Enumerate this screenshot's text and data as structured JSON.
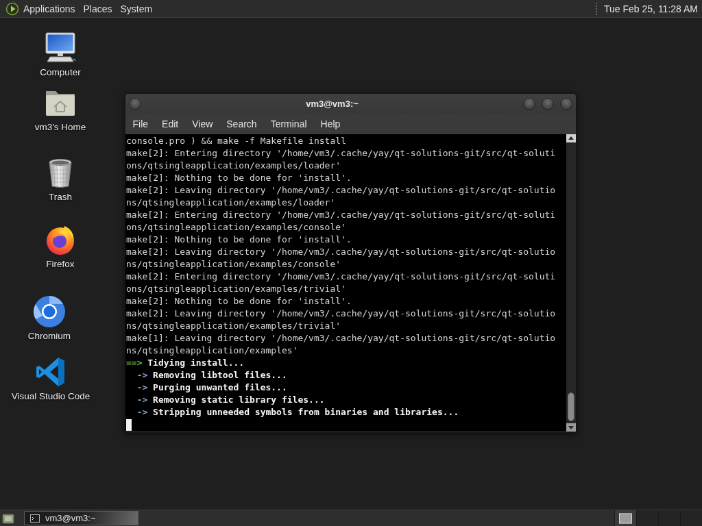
{
  "top_panel": {
    "menus": [
      "Applications",
      "Places",
      "System"
    ],
    "clock": "Tue Feb 25, 11:28 AM"
  },
  "desktop_icons": [
    {
      "kind": "computer",
      "label": "Computer"
    },
    {
      "kind": "home",
      "label": "vm3's Home"
    },
    {
      "kind": "trash",
      "label": "Trash"
    },
    {
      "kind": "firefox",
      "label": "Firefox"
    },
    {
      "kind": "chromium",
      "label": "Chromium"
    },
    {
      "kind": "vscode",
      "label": "Visual Studio Code"
    }
  ],
  "terminal_window": {
    "title": "vm3@vm3:~",
    "menu": [
      "File",
      "Edit",
      "View",
      "Search",
      "Terminal",
      "Help"
    ],
    "cursor": true,
    "lines": [
      {
        "kind": "output",
        "text": "console.pro ) && make -f Makefile install"
      },
      {
        "kind": "output",
        "text": "make[2]: Entering directory '/home/vm3/.cache/yay/qt-solutions-git/src/qt-soluti"
      },
      {
        "kind": "output",
        "text": "ons/qtsingleapplication/examples/loader'"
      },
      {
        "kind": "output",
        "text": "make[2]: Nothing to be done for 'install'."
      },
      {
        "kind": "output",
        "text": "make[2]: Leaving directory '/home/vm3/.cache/yay/qt-solutions-git/src/qt-solutio"
      },
      {
        "kind": "output",
        "text": "ns/qtsingleapplication/examples/loader'"
      },
      {
        "kind": "output",
        "text": "make[2]: Entering directory '/home/vm3/.cache/yay/qt-solutions-git/src/qt-soluti"
      },
      {
        "kind": "output",
        "text": "ons/qtsingleapplication/examples/console'"
      },
      {
        "kind": "output",
        "text": "make[2]: Nothing to be done for 'install'."
      },
      {
        "kind": "output",
        "text": "make[2]: Leaving directory '/home/vm3/.cache/yay/qt-solutions-git/src/qt-solutio"
      },
      {
        "kind": "output",
        "text": "ns/qtsingleapplication/examples/console'"
      },
      {
        "kind": "output",
        "text": "make[2]: Entering directory '/home/vm3/.cache/yay/qt-solutions-git/src/qt-soluti"
      },
      {
        "kind": "output",
        "text": "ons/qtsingleapplication/examples/trivial'"
      },
      {
        "kind": "output",
        "text": "make[2]: Nothing to be done for 'install'."
      },
      {
        "kind": "output",
        "text": "make[2]: Leaving directory '/home/vm3/.cache/yay/qt-solutions-git/src/qt-solutio"
      },
      {
        "kind": "output",
        "text": "ns/qtsingleapplication/examples/trivial'"
      },
      {
        "kind": "output",
        "text": "make[1]: Leaving directory '/home/vm3/.cache/yay/qt-solutions-git/src/qt-solutio"
      },
      {
        "kind": "output",
        "text": "ns/qtsingleapplication/examples'"
      },
      {
        "kind": "stage",
        "marker": "==>",
        "text": "Tidying install..."
      },
      {
        "kind": "step",
        "marker": "->",
        "text": "Removing libtool files..."
      },
      {
        "kind": "step",
        "marker": "->",
        "text": "Purging unwanted files..."
      },
      {
        "kind": "step",
        "marker": "->",
        "text": "Removing static library files..."
      },
      {
        "kind": "step",
        "marker": "->",
        "text": "Stripping unneeded symbols from binaries and libraries..."
      }
    ]
  },
  "bottom_panel": {
    "tasks": [
      {
        "label": "vm3@vm3:~",
        "selected": true
      }
    ],
    "workspaces": [
      {
        "selected": true
      },
      {
        "selected": false
      },
      {
        "selected": false
      },
      {
        "selected": false
      }
    ]
  }
}
